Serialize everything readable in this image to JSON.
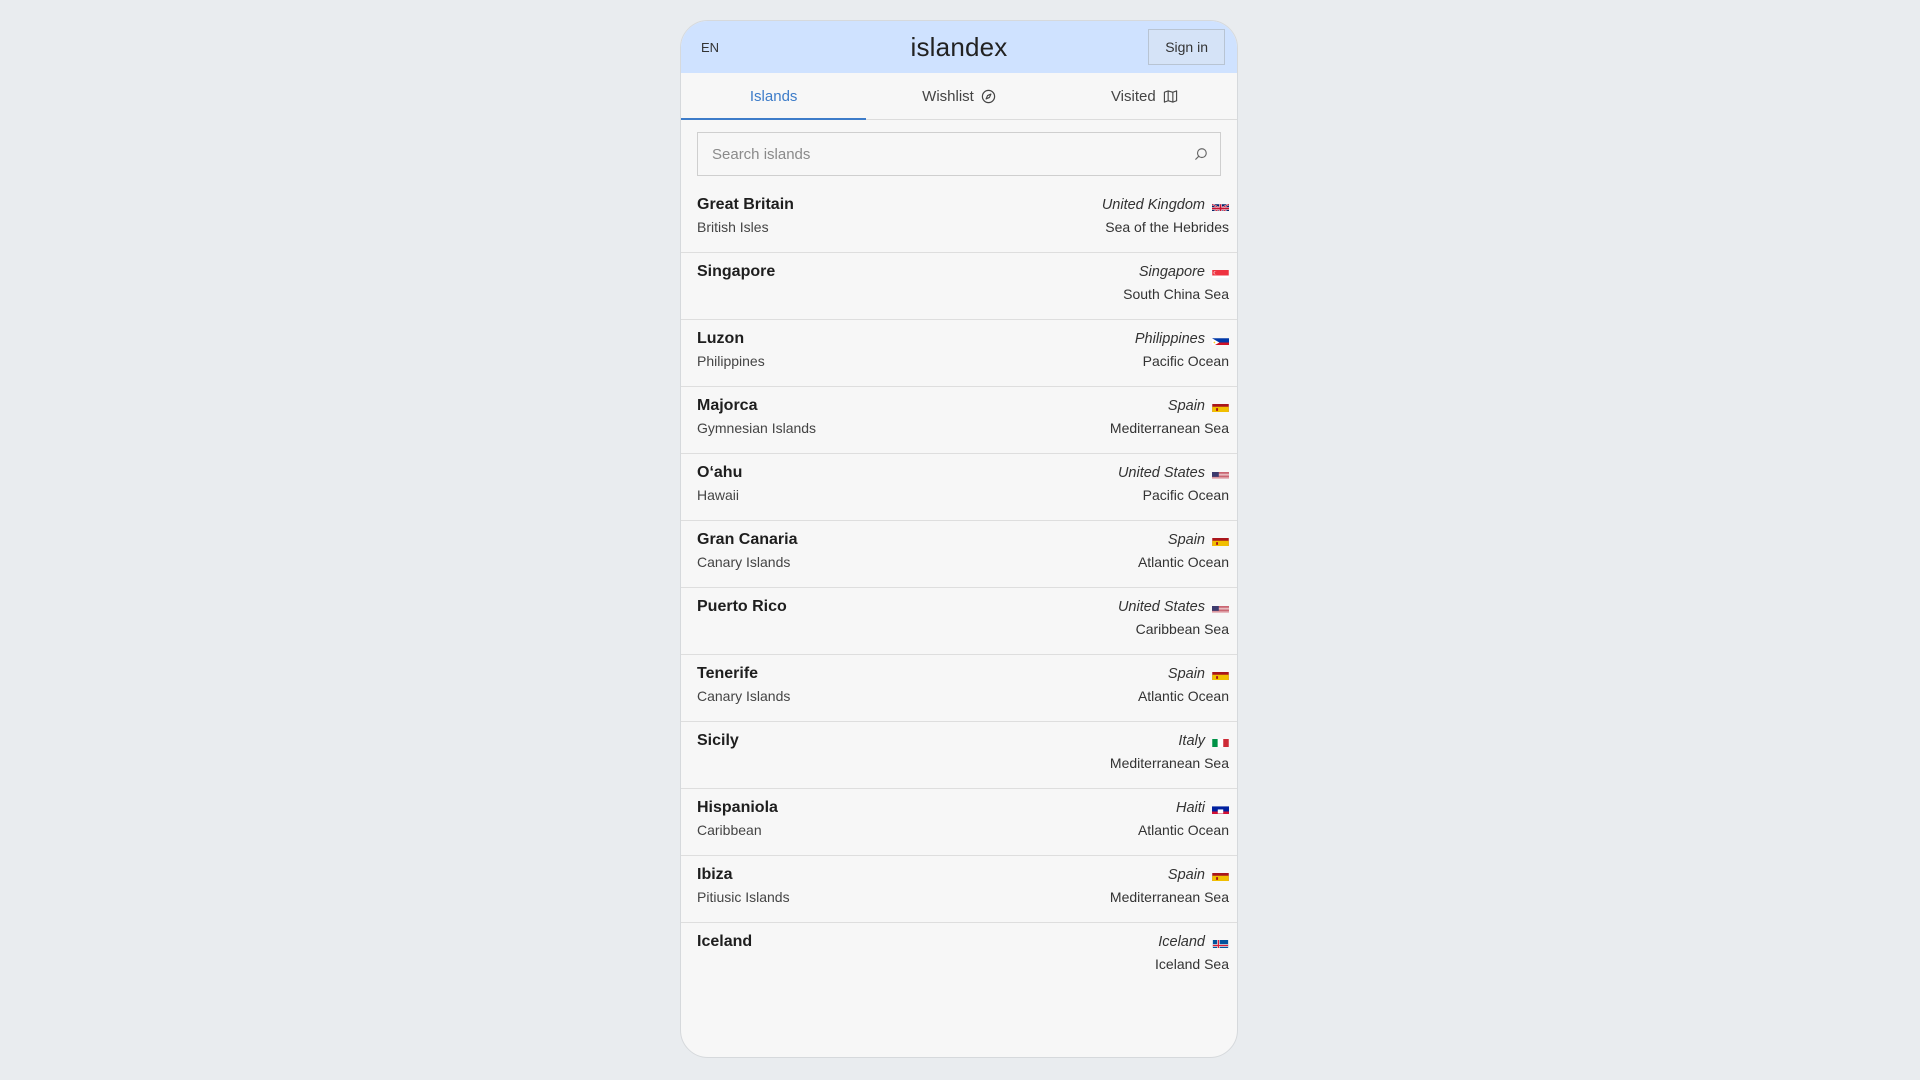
{
  "header": {
    "lang": "EN",
    "title": "islandex",
    "signin": "Sign in"
  },
  "tabs": [
    {
      "label": "Islands",
      "icon": ""
    },
    {
      "label": "Wishlist",
      "icon": "compass-icon"
    },
    {
      "label": "Visited",
      "icon": "map-icon"
    }
  ],
  "search": {
    "placeholder": "Search islands",
    "value": ""
  },
  "colors": {
    "accent": "#3d7cc9",
    "header_bg": "#cfe2ff"
  },
  "islands": [
    {
      "name": "Great Britain",
      "group": "British Isles",
      "country": "United Kingdom",
      "sea": "Sea of the Hebrides",
      "flag": "uk-flag-icon"
    },
    {
      "name": "Singapore",
      "group": "",
      "country": "Singapore",
      "sea": "South China Sea",
      "flag": "singapore-flag-icon"
    },
    {
      "name": "Luzon",
      "group": "Philippines",
      "country": "Philippines",
      "sea": "Pacific Ocean",
      "flag": "philippines-flag-icon"
    },
    {
      "name": "Majorca",
      "group": "Gymnesian Islands",
      "country": "Spain",
      "sea": "Mediterranean Sea",
      "flag": "spain-flag-icon"
    },
    {
      "name": "Oʻahu",
      "group": "Hawaii",
      "country": "United States",
      "sea": "Pacific Ocean",
      "flag": "us-flag-icon"
    },
    {
      "name": "Gran Canaria",
      "group": "Canary Islands",
      "country": "Spain",
      "sea": "Atlantic Ocean",
      "flag": "spain-flag-icon"
    },
    {
      "name": "Puerto Rico",
      "group": "",
      "country": "United States",
      "sea": "Caribbean Sea",
      "flag": "us-flag-icon"
    },
    {
      "name": "Tenerife",
      "group": "Canary Islands",
      "country": "Spain",
      "sea": "Atlantic Ocean",
      "flag": "spain-flag-icon"
    },
    {
      "name": "Sicily",
      "group": "",
      "country": "Italy",
      "sea": "Mediterranean Sea",
      "flag": "italy-flag-icon"
    },
    {
      "name": "Hispaniola",
      "group": "Caribbean",
      "country": "Haiti",
      "sea": "Atlantic Ocean",
      "flag": "haiti-flag-icon"
    },
    {
      "name": "Ibiza",
      "group": "Pitiusic Islands",
      "country": "Spain",
      "sea": "Mediterranean Sea",
      "flag": "spain-flag-icon"
    },
    {
      "name": "Iceland",
      "group": "",
      "country": "Iceland",
      "sea": "Iceland Sea",
      "flag": "iceland-flag-icon"
    }
  ]
}
